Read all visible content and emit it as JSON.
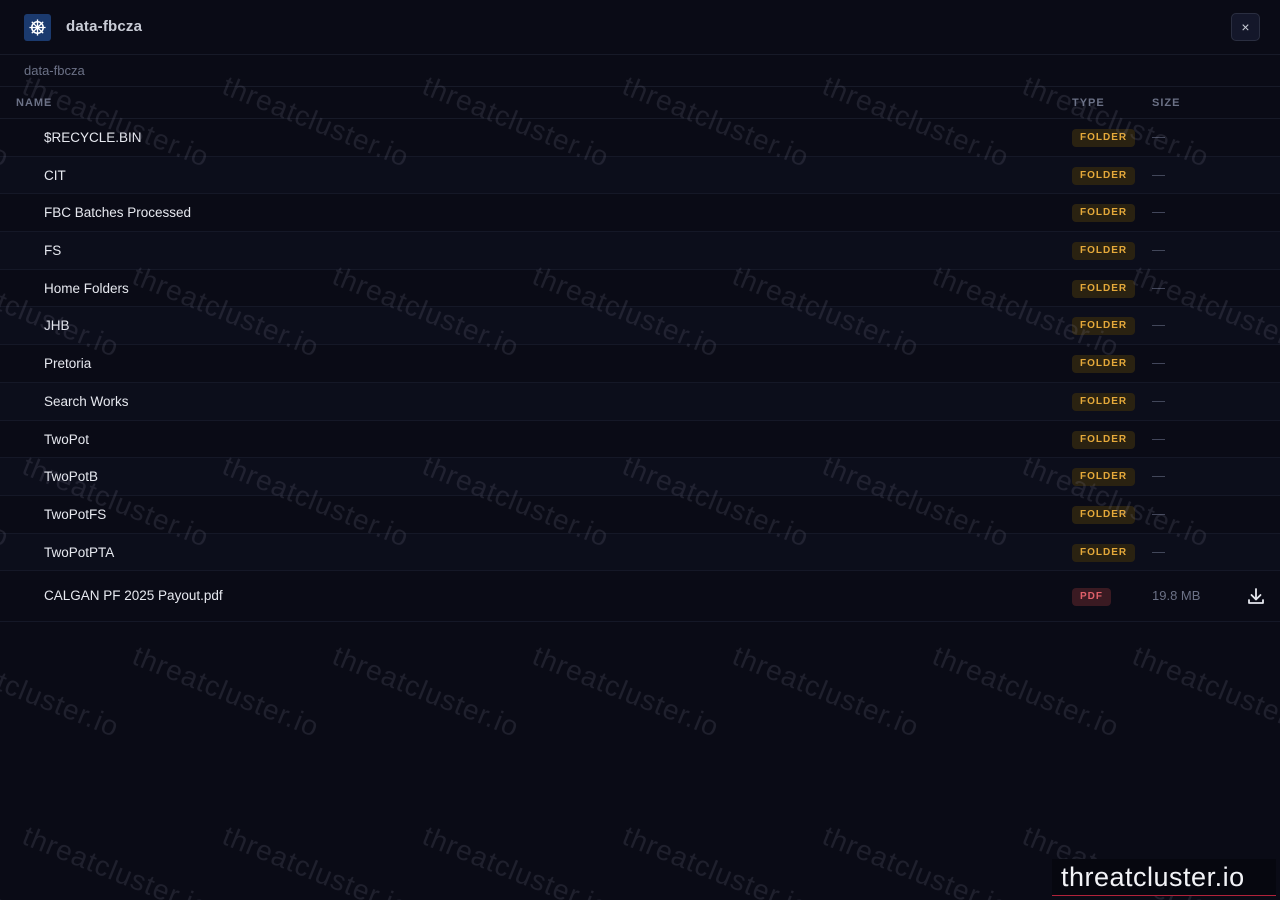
{
  "header": {
    "title": "data-fbcza",
    "close_label": "×"
  },
  "breadcrumb": {
    "items": [
      "data-fbcza"
    ]
  },
  "table": {
    "columns": {
      "name": "NAME",
      "type": "TYPE",
      "size": "SIZE"
    },
    "rows": [
      {
        "name": "$RECYCLE.BIN",
        "type": "FOLDER",
        "size": "—"
      },
      {
        "name": "CIT",
        "type": "FOLDER",
        "size": "—"
      },
      {
        "name": "FBC Batches Processed",
        "type": "FOLDER",
        "size": "—"
      },
      {
        "name": "FS",
        "type": "FOLDER",
        "size": "—"
      },
      {
        "name": "Home Folders",
        "type": "FOLDER",
        "size": "—"
      },
      {
        "name": "JHB",
        "type": "FOLDER",
        "size": "—"
      },
      {
        "name": "Pretoria",
        "type": "FOLDER",
        "size": "—"
      },
      {
        "name": "Search Works",
        "type": "FOLDER",
        "size": "—"
      },
      {
        "name": "TwoPot",
        "type": "FOLDER",
        "size": "—"
      },
      {
        "name": "TwoPotB",
        "type": "FOLDER",
        "size": "—"
      },
      {
        "name": "TwoPotFS",
        "type": "FOLDER",
        "size": "—"
      },
      {
        "name": "TwoPotPTA",
        "type": "FOLDER",
        "size": "—"
      }
    ],
    "file": {
      "name": "CALGAN PF 2025 Payout.pdf",
      "type": "PDF",
      "size": "19.8 MB",
      "action_icon": "download-icon"
    }
  },
  "watermark": {
    "text": "threatcluster.io"
  },
  "brand": {
    "text": "threatcluster.io"
  },
  "colors": {
    "background": "#0a0b16",
    "folder_badge": "#e5a93a",
    "pdf_badge": "#e0606a",
    "brand_underline": "#b0223a",
    "logo_bg": "#1b3a6e"
  },
  "icons": {
    "logo": "helm-wheel-icon",
    "close": "close-icon",
    "download": "download-icon"
  }
}
